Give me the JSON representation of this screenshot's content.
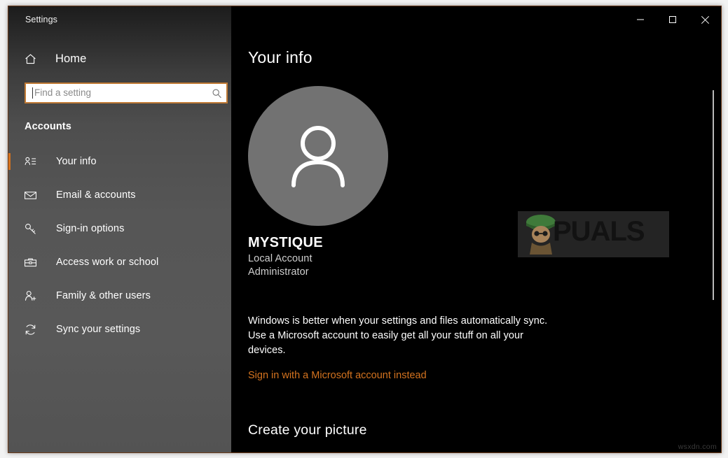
{
  "window": {
    "title": "Settings",
    "controls": {
      "minimize": "minimize-button",
      "maximize": "maximize-button",
      "close": "close-button"
    }
  },
  "sidebar": {
    "home_label": "Home",
    "home_icon": "home-icon",
    "search": {
      "placeholder": "Find a setting",
      "value": "",
      "icon": "search-icon"
    },
    "section_title": "Accounts",
    "items": [
      {
        "label": "Your info",
        "icon": "contact-card-icon",
        "active": true
      },
      {
        "label": "Email & accounts",
        "icon": "envelope-icon",
        "active": false
      },
      {
        "label": "Sign-in options",
        "icon": "key-icon",
        "active": false
      },
      {
        "label": "Access work or school",
        "icon": "briefcase-icon",
        "active": false
      },
      {
        "label": "Family & other users",
        "icon": "person-add-icon",
        "active": false
      },
      {
        "label": "Sync your settings",
        "icon": "sync-icon",
        "active": false
      }
    ]
  },
  "main": {
    "page_title": "Your info",
    "avatar_icon": "person-avatar-icon",
    "account": {
      "name": "MYSTIQUE",
      "type": "Local Account",
      "role": "Administrator"
    },
    "sync": {
      "description": "Windows is better when your settings and files automatically sync. Use a Microsoft account to easily get all your stuff on all your devices.",
      "link_label": "Sign in with a Microsoft account instead"
    },
    "create_picture_heading": "Create your picture"
  },
  "watermark": {
    "brand": "PUALS",
    "site": "wsxdn.com"
  },
  "colors": {
    "accent": "#d4731f",
    "focus_border": "#c07a35",
    "sidebar": "#565656",
    "main_bg": "#000000",
    "avatar_bg": "#727272"
  }
}
